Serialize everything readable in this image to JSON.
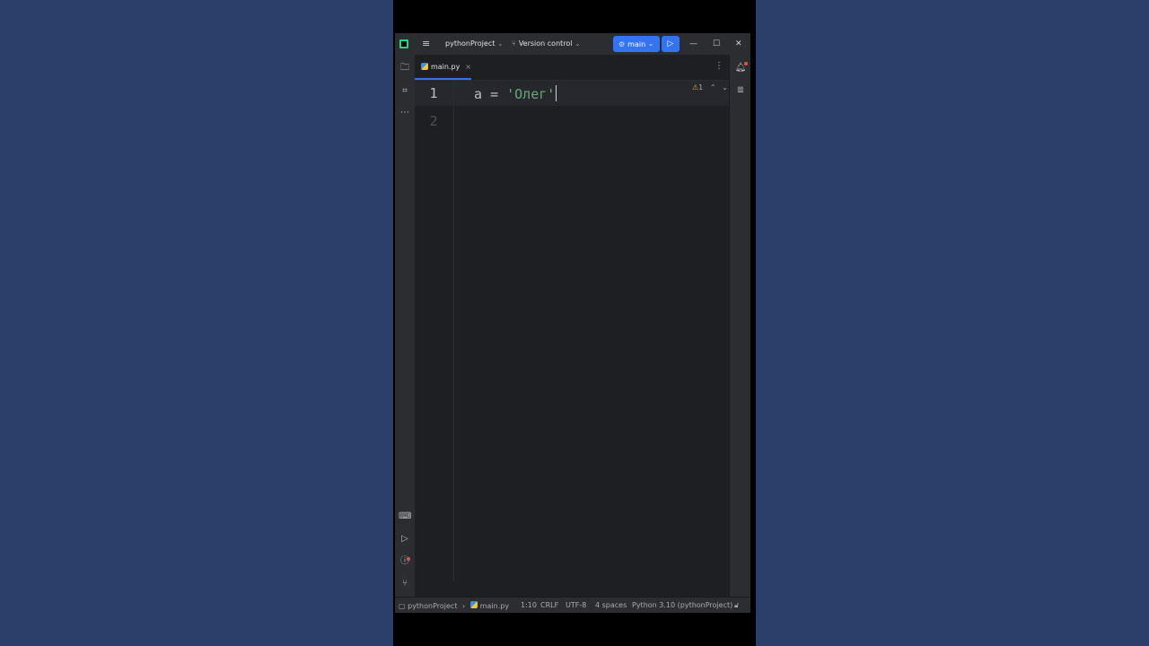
{
  "titlebar": {
    "project": "pythonProject",
    "version_control": "Version control",
    "run_config": "main"
  },
  "tabs": [
    {
      "label": "main.py"
    }
  ],
  "editor": {
    "line_numbers": [
      "1",
      "2"
    ],
    "code": {
      "var": "a",
      "op": "=",
      "str": "'Олег'"
    },
    "inspection_count": "1"
  },
  "statusbar": {
    "breadcrumb_project": "pythonProject",
    "breadcrumb_file": "main.py",
    "position": "1:10",
    "line_sep": "CRLF",
    "encoding": "UTF-8",
    "indent": "4 spaces",
    "interpreter": "Python 3.10 (pythonProject)"
  },
  "colors": {
    "accent": "#3574f0",
    "string": "#6aab73",
    "background": "#1e1f22",
    "page_bg": "#2b3f6a"
  }
}
